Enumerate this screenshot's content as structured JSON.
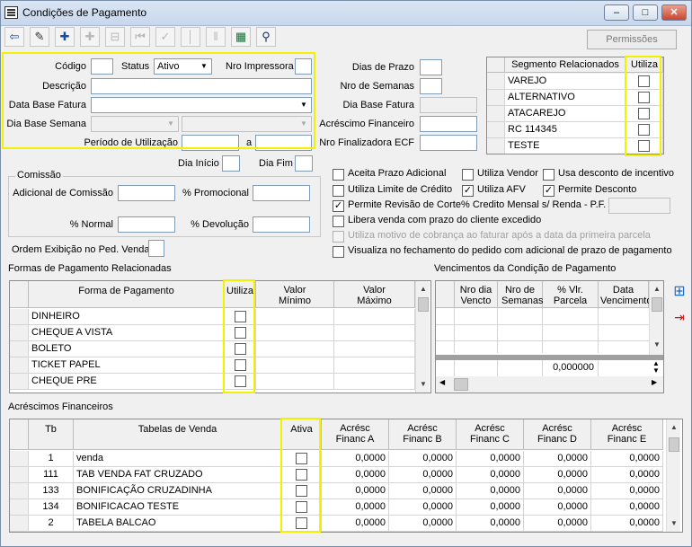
{
  "window": {
    "title": "Condições de Pagamento",
    "min": "–",
    "max": "□",
    "close": "✕"
  },
  "toolbar": {
    "buttons": [
      {
        "name": "exit-icon",
        "glyph": "⇦"
      },
      {
        "name": "edit-icon",
        "glyph": "✎"
      },
      {
        "name": "add-icon",
        "glyph": "✚"
      },
      {
        "name": "add-dim-icon",
        "glyph": "✚"
      },
      {
        "name": "remove-dim-icon",
        "glyph": "⊟"
      },
      {
        "name": "first-dim-icon",
        "glyph": "⏮"
      },
      {
        "name": "check-dim-icon",
        "glyph": "✓"
      },
      {
        "name": "prev-dim-icon",
        "glyph": "│"
      },
      {
        "name": "next-dim-icon",
        "glyph": "‖"
      },
      {
        "name": "report-icon",
        "glyph": "▦"
      },
      {
        "name": "search-binoculars-icon",
        "glyph": "⚲"
      }
    ],
    "permissions_label": "Permissões"
  },
  "form": {
    "codigo_label": "Código",
    "codigo_value": "",
    "status_label": "Status",
    "status_value": "Ativo",
    "nro_impressora_label": "Nro Impressora",
    "nro_impressora_value": "",
    "descricao_label": "Descrição",
    "descricao_value": "",
    "data_base_fatura_label": "Data Base Fatura",
    "data_base_fatura_value": "",
    "data_base_semana_label": "Dia Base Semana",
    "data_base_semana_value": "",
    "data_base_semana_value2": "",
    "periodo_label": "Período de Utilização",
    "periodo_sep": "a",
    "periodo_de": "",
    "periodo_ate": "",
    "dias_prazo_label": "Dias de Prazo",
    "dias_prazo_value": "",
    "nro_semanas_label": "Nro de Semanas",
    "nro_semanas_value": "",
    "dia_base_fatura_label": "Dia Base Fatura",
    "dia_base_fatura_value": "",
    "acrescimo_label": "Acréscimo Financeiro",
    "acrescimo_value": "",
    "nro_finalizadora_label": "Nro Finalizadora ECF",
    "nro_finalizadora_value": "",
    "dia_inicio_label": "Dia Início",
    "dia_inicio_value": "",
    "dia_fim_label": "Dia Fim",
    "dia_fim_value": "",
    "comissao_title": "Comissão",
    "adicional_comissao_label": "Adicional de Comissão",
    "adicional_comissao_value": "",
    "promocional_label": "% Promocional",
    "promocional_value": "",
    "normal_label": "% Normal",
    "normal_value": "",
    "devolucao_label": "% Devolução",
    "devolucao_value": "",
    "ordem_exibicao_label": "Ordem Exibição no Ped. Venda"
  },
  "segmentos": {
    "header_segmento": "Segmento Relacionados",
    "header_utiliza": "Utiliza",
    "rows": [
      "VAREJO",
      "ALTERNATIVO",
      "ATACAREJO",
      "RC 114345",
      "TESTE"
    ]
  },
  "options": {
    "aceita_prazo": "Aceita Prazo Adicional",
    "utiliza_vendor": "Utiliza Vendor",
    "usa_desconto": "Usa desconto de incentivo",
    "utiliza_limite": "Utiliza Limite de Crédito",
    "utiliza_afv": "Utiliza AFV",
    "permite_desconto": "Permite Desconto",
    "permite_revisao": "Permite Revisão de Corte",
    "credito_mensal": "% Credito Mensal s/ Renda - P.F.",
    "libera_venda": "Libera venda com prazo do cliente excedido",
    "utiliza_motivo": "Utiliza motivo de cobrança ao faturar após a data da primeira parcela",
    "visualiza": "Visualiza no fechamento do pedido com adicional de prazo de pagamento",
    "credito_mensal_value": ""
  },
  "formas": {
    "title": "Formas de Pagamento Relacionadas",
    "headers": [
      "Forma de Pagamento",
      "Utiliza",
      "Valor Mínimo",
      "Valor Máximo"
    ],
    "rows": [
      "DINHEIRO",
      "CHEQUE A VISTA",
      "BOLETO",
      "TICKET PAPEL",
      "CHEQUE PRE"
    ]
  },
  "vencimentos": {
    "title": "Vencimentos da Condição de Pagamento",
    "headers": [
      "Nro dia Vencto",
      "Nro de Semanas",
      "% Vlr. Parcela",
      "Data Vencimento"
    ],
    "total": "0,000000"
  },
  "acrescimos": {
    "title": "Acréscimos Financeiros",
    "headers": [
      "Tb",
      "Tabelas de Venda",
      "Ativa",
      "Acrésc Financ A",
      "Acrésc Financ B",
      "Acrésc Financ C",
      "Acrésc Financ D",
      "Acrésc Financ E"
    ],
    "rows": [
      {
        "tb": "1",
        "nome": "venda",
        "a": "0,0000",
        "b": "0,0000",
        "c": "0,0000",
        "d": "0,0000",
        "e": "0,0000"
      },
      {
        "tb": "111",
        "nome": "TAB VENDA FAT CRUZADO",
        "a": "0,0000",
        "b": "0,0000",
        "c": "0,0000",
        "d": "0,0000",
        "e": "0,0000"
      },
      {
        "tb": "133",
        "nome": "BONIFICAÇÃO CRUZADINHA",
        "a": "0,0000",
        "b": "0,0000",
        "c": "0,0000",
        "d": "0,0000",
        "e": "0,0000"
      },
      {
        "tb": "134",
        "nome": "BONIFICACAO TESTE",
        "a": "0,0000",
        "b": "0,0000",
        "c": "0,0000",
        "d": "0,0000",
        "e": "0,0000"
      },
      {
        "tb": "2",
        "nome": "TABELA BALCAO",
        "a": "0,0000",
        "b": "0,0000",
        "c": "0,0000",
        "d": "0,0000",
        "e": "0,0000"
      }
    ]
  }
}
